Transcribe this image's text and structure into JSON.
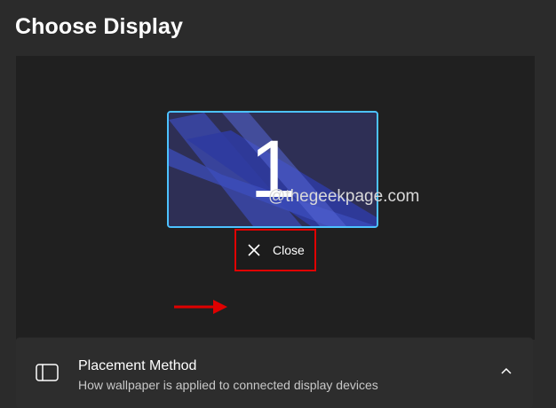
{
  "header": {
    "title": "Choose Display"
  },
  "display": {
    "monitor_number": "1",
    "accent_color": "#4cc2ff"
  },
  "watermark": {
    "text": "@thegeekpage.com"
  },
  "close_button": {
    "label": "Close",
    "icon": "close-icon",
    "highlight_color": "#e00000"
  },
  "annotation": {
    "icon": "arrow-right-icon",
    "color": "#e00000"
  },
  "placement_method": {
    "title": "Placement Method",
    "description": "How wallpaper is applied to connected display devices",
    "icon": "display-panel-icon",
    "expand_icon": "chevron-up-icon"
  }
}
